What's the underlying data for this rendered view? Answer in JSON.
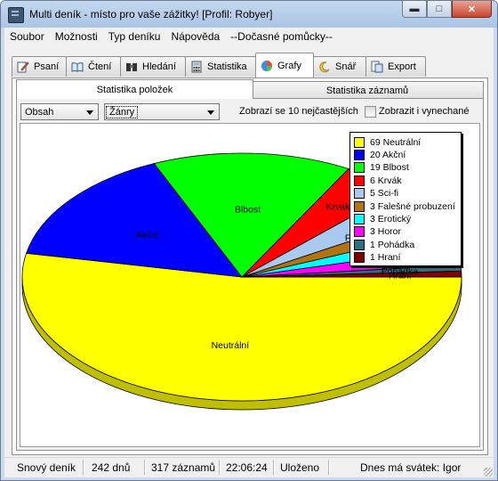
{
  "window": {
    "title": "Multi deník - místo pro vaše zážitky! [Profil: Robyer]"
  },
  "menu": [
    "Soubor",
    "Možnosti",
    "Typ deníku",
    "Nápověda",
    "--Dočasné pomůcky--"
  ],
  "tabs": [
    {
      "label": "Psaní",
      "icon": "pencil-notepad-icon"
    },
    {
      "label": "Čtení",
      "icon": "open-book-icon"
    },
    {
      "label": "Hledání",
      "icon": "binoculars-icon"
    },
    {
      "label": "Statistika",
      "icon": "calculator-icon"
    },
    {
      "label": "Grafy",
      "icon": "pie-chart-icon"
    },
    {
      "label": "Snář",
      "icon": "moon-sleep-icon"
    },
    {
      "label": "Export",
      "icon": "export-document-icon"
    }
  ],
  "active_tab": "Grafy",
  "subtabs": [
    "Statistika položek",
    "Statistika záznamů"
  ],
  "controls": {
    "select_content": "Obsah",
    "select_category": "Žánry",
    "top_info": "Zobrazí se 10 nejčastějších",
    "show_skipped_label": "Zobrazit i vynechané"
  },
  "colors": {
    "accent_close": "#c9452f"
  },
  "chart_data": {
    "type": "pie",
    "title": "",
    "slices": [
      {
        "label": "Neutrální",
        "value": 69,
        "color": "#ffff00"
      },
      {
        "label": "Akční",
        "value": 20,
        "color": "#0000ff"
      },
      {
        "label": "Blbost",
        "value": 19,
        "color": "#00ff00"
      },
      {
        "label": "Krvák",
        "value": 6,
        "color": "#ff0000"
      },
      {
        "label": "Sci-fi",
        "value": 5,
        "color": "#a9c9f0"
      },
      {
        "label": "Falešné probuzení",
        "value": 3,
        "color": "#b07510"
      },
      {
        "label": "Erotický",
        "value": 3,
        "color": "#00ffff"
      },
      {
        "label": "Horor",
        "value": 3,
        "color": "#ff00ff"
      },
      {
        "label": "Pohádka",
        "value": 1,
        "color": "#2f6f7f"
      },
      {
        "label": "Hraní",
        "value": 1,
        "color": "#7f0000"
      }
    ],
    "legend": [
      "69 Neutrální",
      "20 Akční",
      "19 Blbost",
      "6 Krvák",
      "5 Sci-fi",
      "3 Falešné probuzení",
      "3 Erotický",
      "3 Horor",
      "1 Pohádka",
      "1 Hraní"
    ],
    "legend_position": "top-right"
  },
  "status": {
    "diary": "Snový deník",
    "days": "242 dnů",
    "records": "317 záznamů",
    "time": "22:06:24",
    "saved": "Uloženo",
    "nameday": "Dnes má svátek: Igor"
  }
}
